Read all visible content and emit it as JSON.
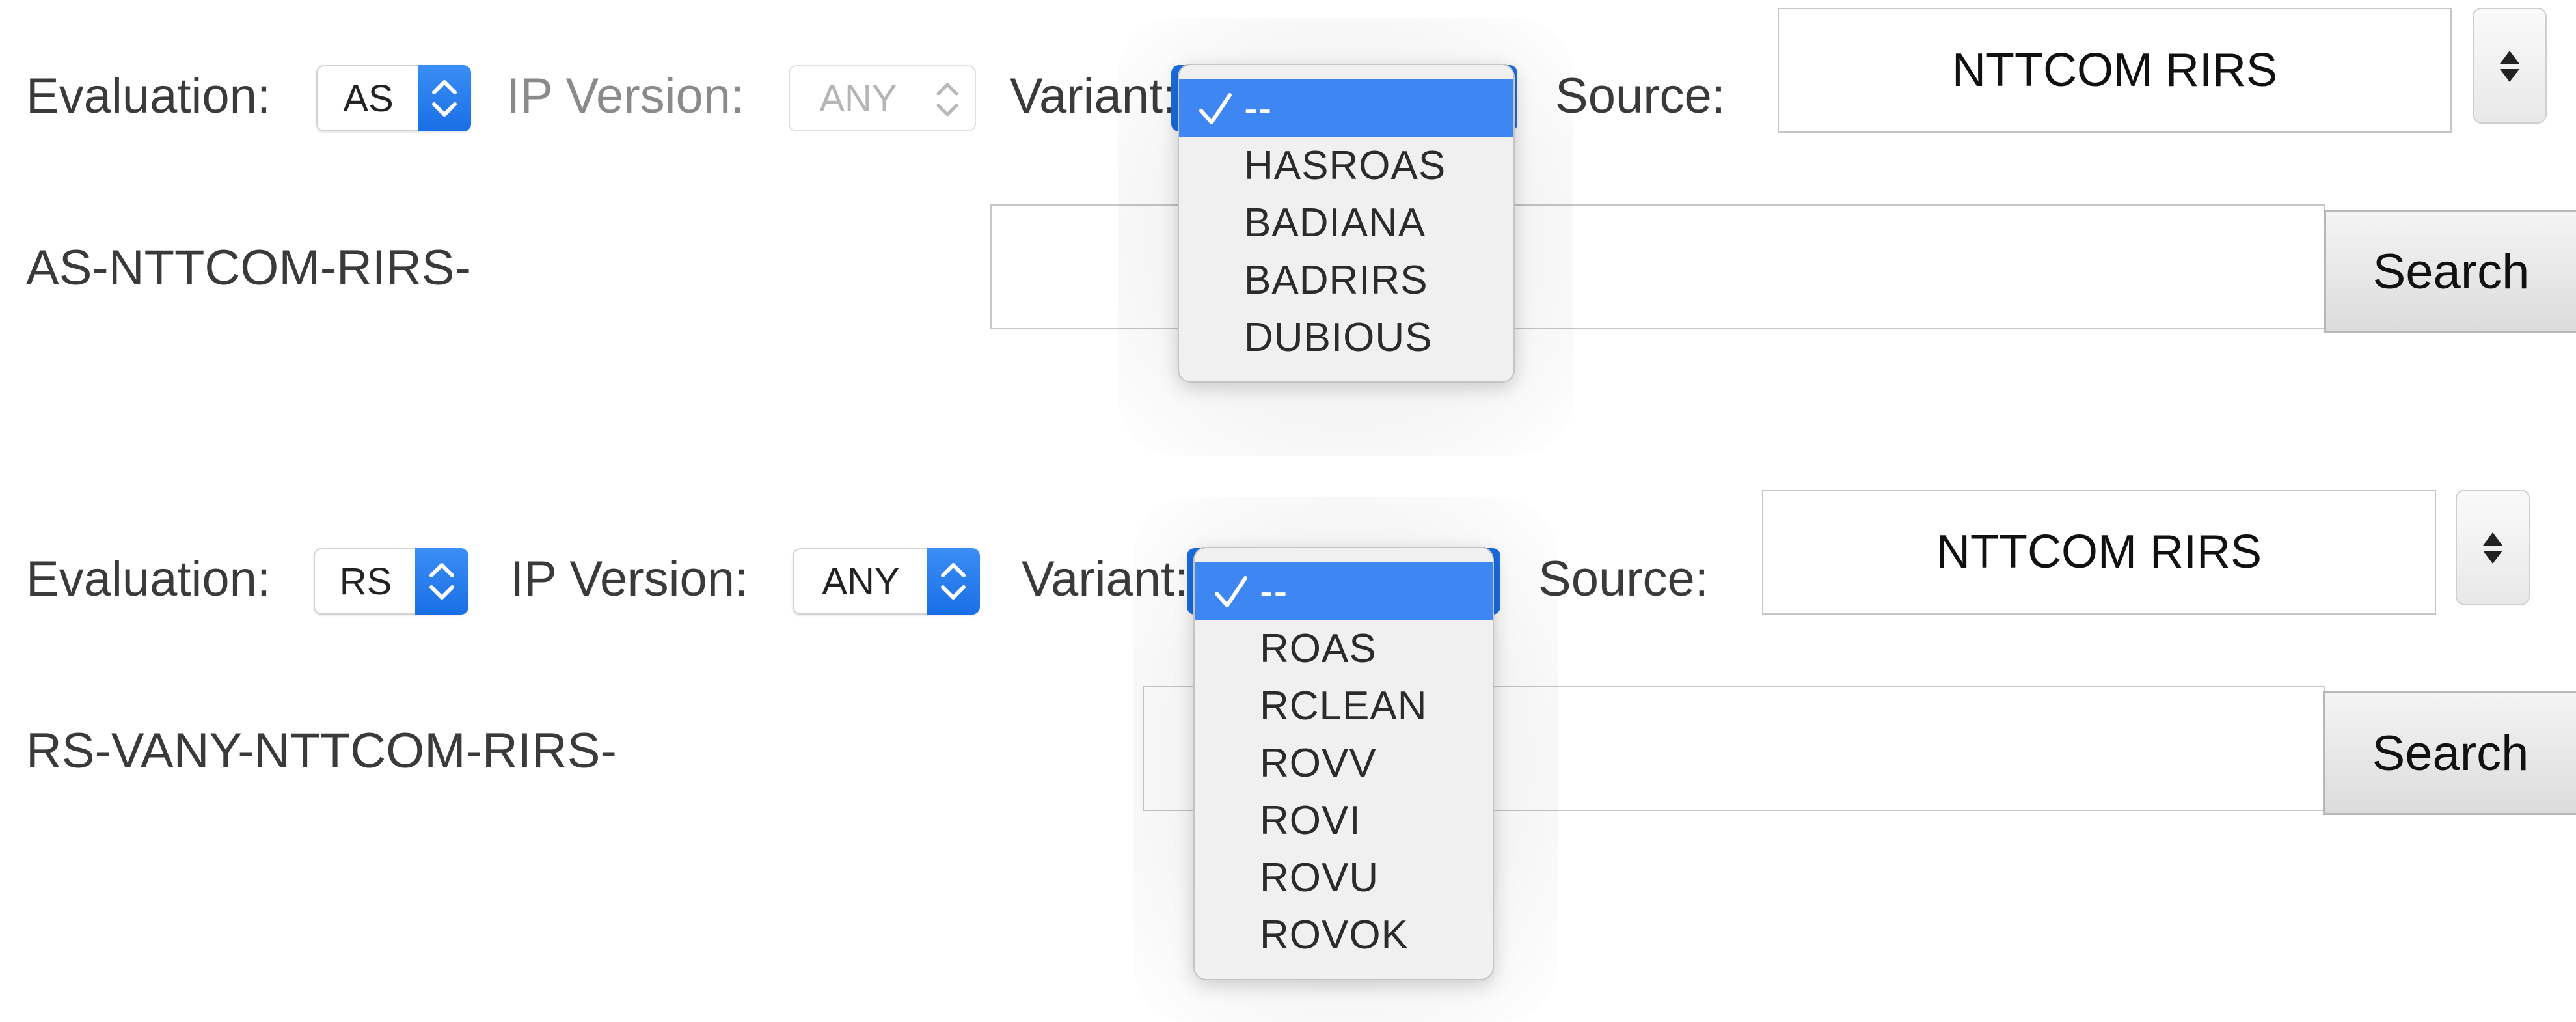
{
  "form1": {
    "evaluation_label": "Evaluation:",
    "evaluation_value": "AS",
    "ip_version_label": "IP Version:",
    "ip_version_value": "ANY",
    "ip_version_disabled": true,
    "variant_label": "Variant:",
    "variant_options": [
      "--",
      "HASROAS",
      "BADIANA",
      "BADRIRS",
      "DUBIOUS"
    ],
    "variant_selected": "--",
    "source_label": "Source:",
    "source_value": "NTTCOM RIRS",
    "prefix": "AS-NTTCOM-RIRS-",
    "search_value": "",
    "search_label": "Search"
  },
  "form2": {
    "evaluation_label": "Evaluation:",
    "evaluation_value": "RS",
    "ip_version_label": "IP Version:",
    "ip_version_value": "ANY",
    "ip_version_disabled": false,
    "variant_label": "Variant:",
    "variant_options": [
      "--",
      "ROAS",
      "RCLEAN",
      "ROVV",
      "ROVI",
      "ROVU",
      "ROVOK"
    ],
    "variant_selected": "--",
    "source_label": "Source:",
    "source_value": "NTTCOM RIRS",
    "prefix": "RS-VANY-NTTCOM-RIRS-",
    "search_value": "",
    "search_label": "Search"
  },
  "colors": {
    "accent": "#3e86f2",
    "menu_bg": "#f0f0f0",
    "text": "#3a3a3a"
  },
  "icons": {
    "select_stepper": "chevron-up-down-icon",
    "menu_check": "checkmark-icon",
    "source_stepper": "triangle-up-down-icon"
  }
}
